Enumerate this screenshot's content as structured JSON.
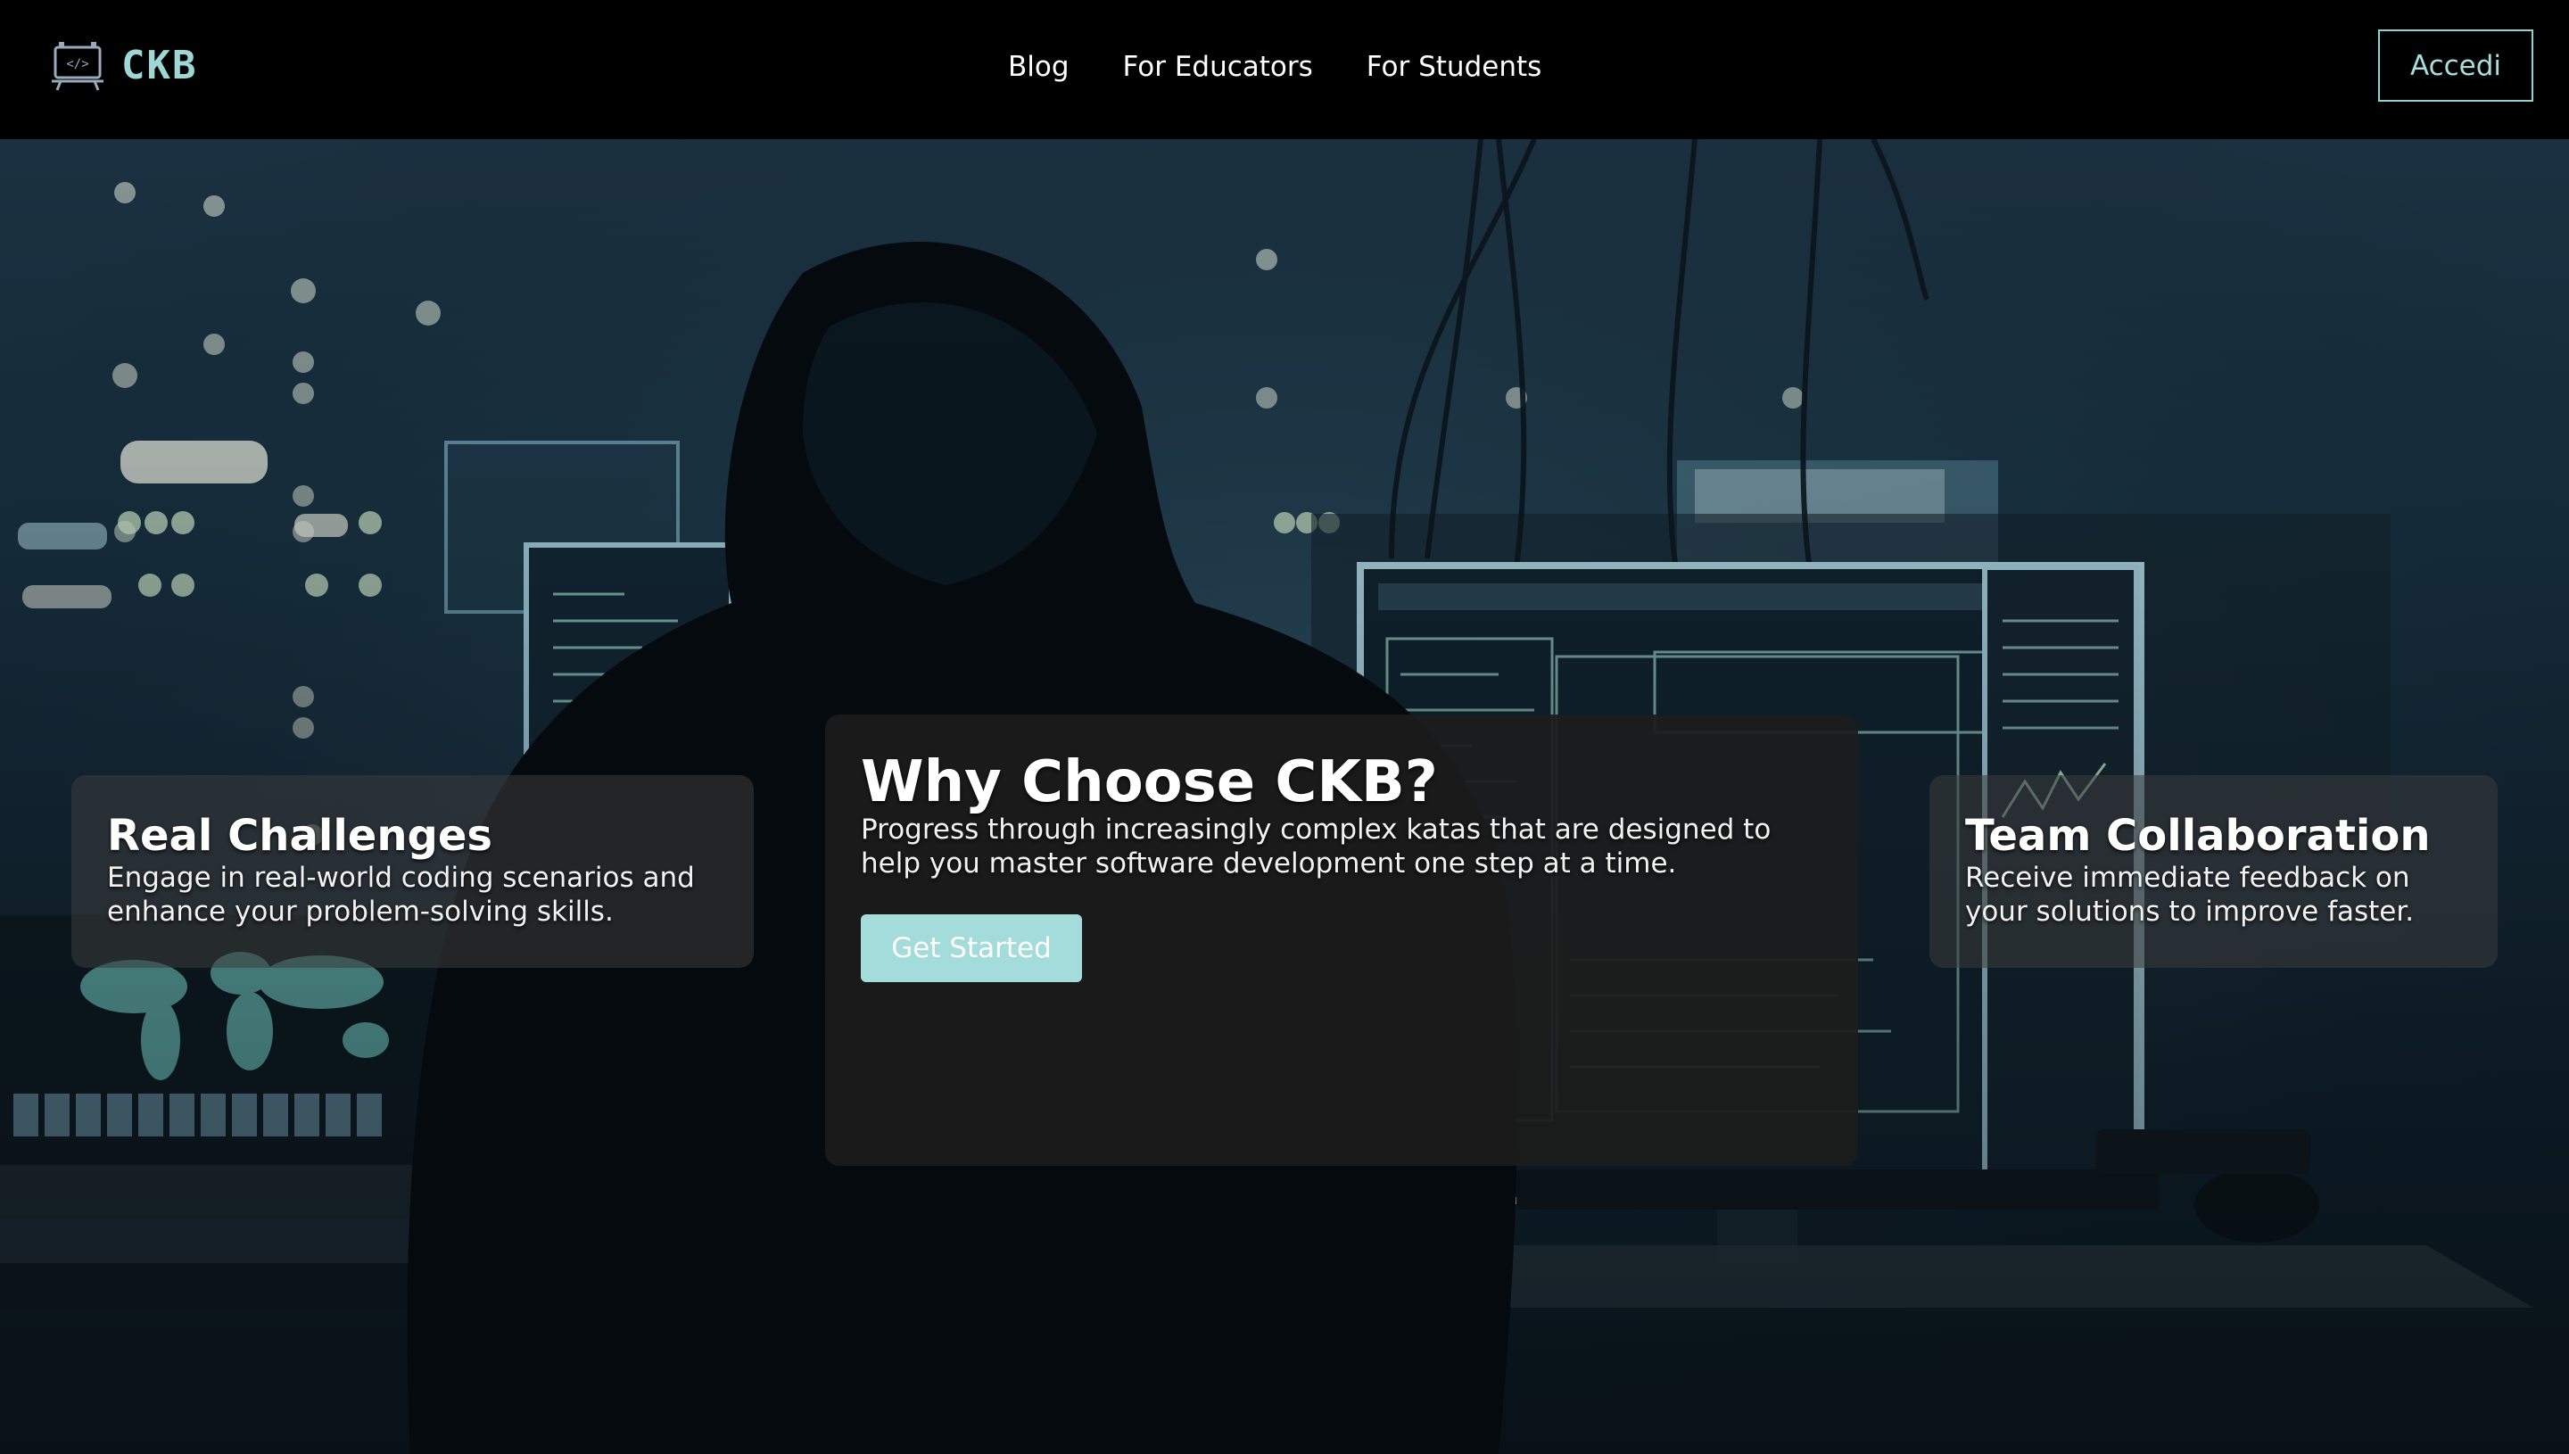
{
  "brand": {
    "name": "CKB",
    "icon": "code-board-icon",
    "color": "#9fd6d6"
  },
  "nav": {
    "items": [
      {
        "label": "Blog"
      },
      {
        "label": "For Educators"
      },
      {
        "label": "For Students"
      }
    ]
  },
  "header": {
    "login_label": "Accedi"
  },
  "hero": {
    "background": "hooded-figure-at-computer-monitors-photo",
    "main_card": {
      "title": "Why Choose CKB?",
      "text": "Progress through increasingly complex katas that are designed to help you master software development one step at a time.",
      "cta_label": "Get Started"
    },
    "left_card": {
      "title": "Real Challenges",
      "text": "Engage in real-world coding scenarios and enhance your problem-solving skills."
    },
    "right_card": {
      "title": "Team Collaboration",
      "text": "Receive immediate feedback on your solutions to improve faster."
    }
  },
  "colors": {
    "accent": "#a4dcdc",
    "header_bg": "#000000",
    "card_main_bg": "#1c1c1c"
  }
}
